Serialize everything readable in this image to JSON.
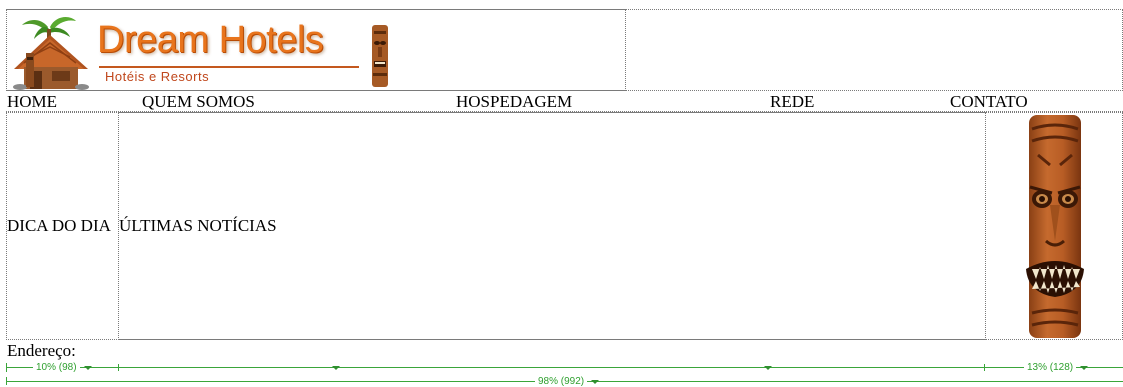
{
  "logo": {
    "title": "Dream Hotels",
    "subtitle": "Hotéis e Resorts"
  },
  "nav": {
    "items": [
      {
        "label": "HOME"
      },
      {
        "label": "QUEM SOMOS"
      },
      {
        "label": "HOSPEDAGEM"
      },
      {
        "label": "REDE"
      },
      {
        "label": "CONTATO"
      }
    ]
  },
  "content": {
    "left": "DICA DO DIA",
    "center": "ÚLTIMAS NOTÍCIAS"
  },
  "footer": {
    "address_label": "Endereço:"
  },
  "rulers": {
    "col_left": "10% (98)",
    "col_right": "13% (128)",
    "table": "98% (992)"
  },
  "colors": {
    "ruler": "#3aa53a",
    "logo_title": "#e8741c"
  }
}
